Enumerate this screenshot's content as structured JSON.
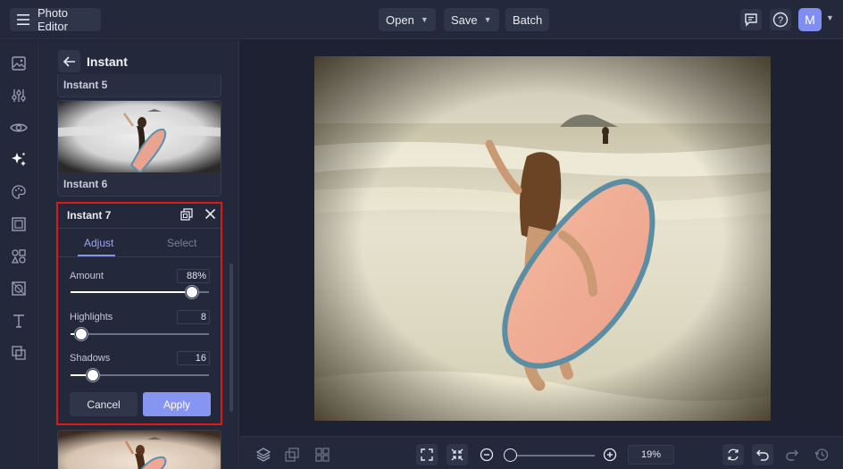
{
  "app": {
    "title": "Photo Editor",
    "avatar_initial": "M"
  },
  "toolbar": {
    "open_label": "Open",
    "save_label": "Save",
    "batch_label": "Batch"
  },
  "panel": {
    "title": "Instant",
    "items": [
      {
        "label": "Instant 5"
      },
      {
        "label": "Instant 6"
      }
    ]
  },
  "adjust": {
    "title": "Instant 7",
    "tabs": [
      {
        "label": "Adjust",
        "active": true
      },
      {
        "label": "Select",
        "active": false
      }
    ],
    "sliders": [
      {
        "label": "Amount",
        "value": "88%",
        "level": 88
      },
      {
        "label": "Highlights",
        "value": "8",
        "level": 8
      },
      {
        "label": "Shadows",
        "value": "16",
        "level": 16
      }
    ],
    "cancel_label": "Cancel",
    "apply_label": "Apply"
  },
  "zoom": {
    "value": "19%",
    "level": 19
  },
  "colors": {
    "accent": "#8795f2",
    "highlight_border": "#e01818",
    "background": "#1d2131",
    "panel": "#23283a"
  }
}
